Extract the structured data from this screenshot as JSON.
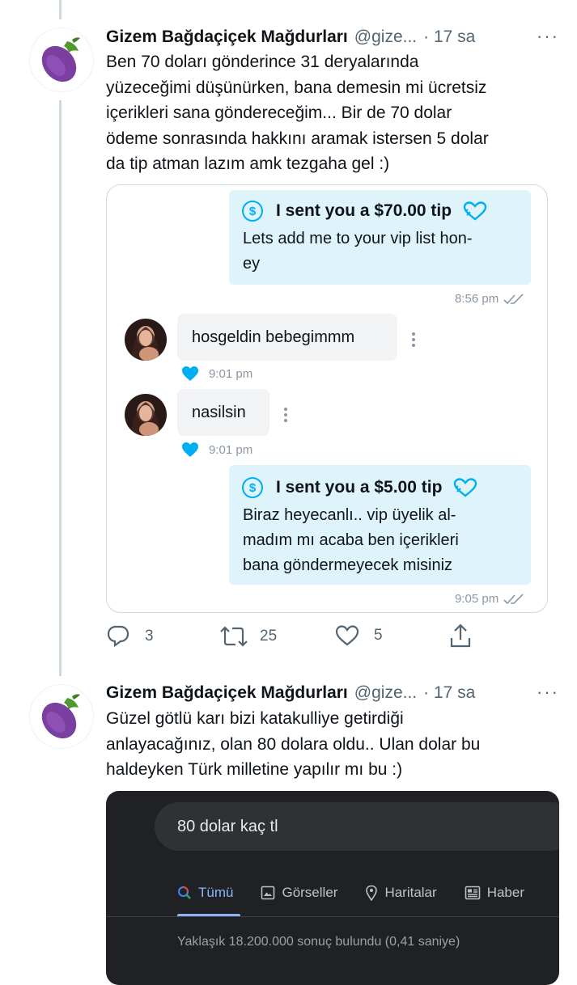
{
  "tweets": [
    {
      "author_name": "Gizem Bağdaçiçek Mağdurları",
      "handle": "@gize...",
      "time": "· 17 sa",
      "avatar_icon": "eggplant-emoji",
      "text_lines": [
        "Ben 70 doları gönderince 31 deryalarında",
        "yüzeceğimi düşünürken, bana demesin mi ücretsiz",
        "içerikleri sana göndereceğim...  Bir de 70 dolar",
        "ödeme sonrasında hakkını aramak istersen 5 dolar",
        "da tip atman lazım amk tezgaha gel :)"
      ],
      "chat": {
        "tip1": {
          "title": "I sent you a $70.00 tip",
          "lines": [
            "Lets add me to your vip list hon-",
            "ey"
          ],
          "time": "8:56 pm"
        },
        "incoming": [
          {
            "text": "hosgeldin bebegimmm",
            "time": "9:01 pm"
          },
          {
            "text": "nasilsin",
            "time": "9:01 pm"
          }
        ],
        "tip2": {
          "title": "I sent you a $5.00 tip",
          "lines": [
            "Biraz heyecanlı.. vip üyelik al-",
            "madım mı acaba ben içerikleri",
            "bana göndermeyecek misiniz"
          ],
          "time": "9:05 pm"
        }
      },
      "actions": {
        "reply_count": "3",
        "retweet_count": "25",
        "like_count": "5"
      }
    },
    {
      "author_name": "Gizem Bağdaçiçek Mağdurları",
      "handle": "@gize...",
      "time": "· 17 sa",
      "avatar_icon": "eggplant-emoji",
      "text_lines": [
        "Güzel götlü karı bizi katakulliye getirdiği",
        "anlayacağınız, olan 80 dolara oldu.. Ulan dolar bu",
        "haldeyken Türk milletine yapılır mı bu :)"
      ],
      "google": {
        "query": "80 dolar kaç tl",
        "tabs": [
          "Tümü",
          "Görseller",
          "Haritalar",
          "Haber"
        ],
        "results_text": "Yaklaşık 18.200.000 sonuç bulundu (0,41 saniye)"
      }
    }
  ],
  "colors": {
    "accent": "#00aff0",
    "bubble_out": "#dff3fb",
    "bubble_in": "#f2f3f5",
    "google_dark": "#202124"
  }
}
